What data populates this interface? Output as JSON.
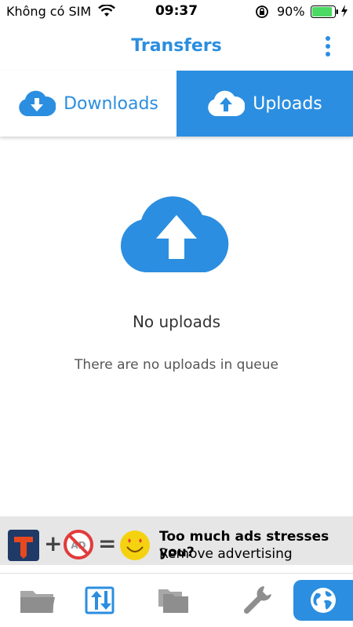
{
  "status_bar": {
    "carrier": "Không có SIM",
    "time": "09:37",
    "battery_percent": "90%",
    "battery_level": 0.9
  },
  "nav": {
    "title": "Transfers"
  },
  "tabs": [
    {
      "label": "Downloads",
      "selected": false
    },
    {
      "label": "Uploads",
      "selected": true
    }
  ],
  "empty_state": {
    "title": "No uploads",
    "subtitle": "There are no uploads in queue"
  },
  "ad_banner": {
    "plus": "+",
    "equals": "=",
    "line1": "Too much ads stresses you?",
    "line2": "Remove advertising"
  },
  "bottom_tabs": [
    {
      "icon": "folder-icon"
    },
    {
      "icon": "transfers-icon",
      "active": true
    },
    {
      "icon": "files-icon"
    },
    {
      "icon": "wrench-icon"
    },
    {
      "icon": "globe-icon"
    }
  ],
  "colors": {
    "accent": "#2b8ee0",
    "ad_background": "#e6e6e6",
    "battery_green": "#4cd964"
  }
}
